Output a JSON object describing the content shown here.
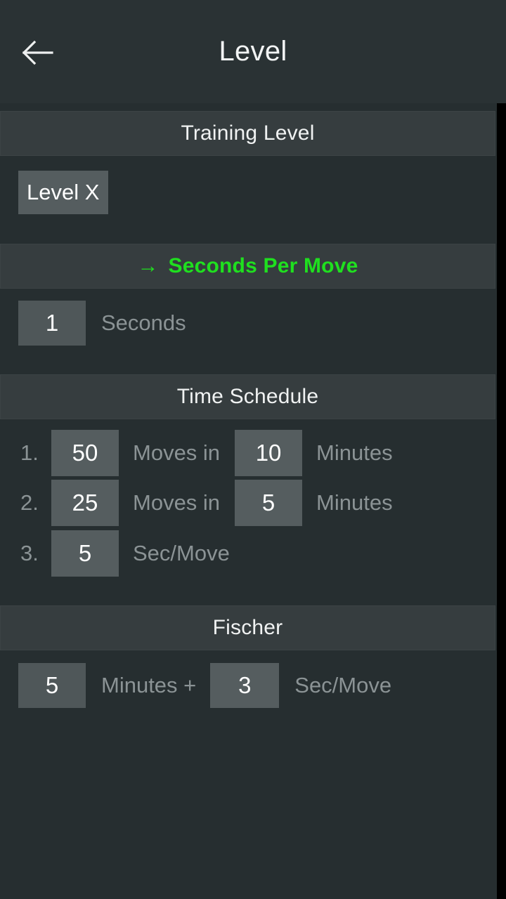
{
  "appbar": {
    "back_icon": "arrow-left-icon",
    "title": "Level"
  },
  "scrollbar": {
    "present": true
  },
  "colors": {
    "background": "#262e30",
    "header_band": "#363d3f",
    "value_box": "#4f5759",
    "label_text": "#8b9395",
    "value_text": "#ffffff",
    "accent_green": "#1fe01f",
    "scrollbar": "#000000"
  },
  "sections": {
    "training_level": {
      "header": "Training Level",
      "level_value": "Level X"
    },
    "seconds_per_move": {
      "header": "Seconds Per Move",
      "arrow_icon": "arrow-right-icon",
      "selected": true,
      "seconds_value": "1",
      "seconds_label": "Seconds"
    },
    "time_schedule": {
      "header": "Time Schedule",
      "rows": [
        {
          "index": "1.",
          "moves": "50",
          "moves_label": "Moves in",
          "minutes": "10",
          "minutes_label": "Minutes"
        },
        {
          "index": "2.",
          "moves": "25",
          "moves_label": "Moves in",
          "minutes": "5",
          "minutes_label": "Minutes"
        },
        {
          "index": "3.",
          "seconds": "5",
          "seconds_label": "Sec/Move"
        }
      ]
    },
    "fischer": {
      "header": "Fischer",
      "minutes": "5",
      "minutes_label": "Minutes +",
      "increment": "3",
      "increment_label": "Sec/Move"
    }
  }
}
